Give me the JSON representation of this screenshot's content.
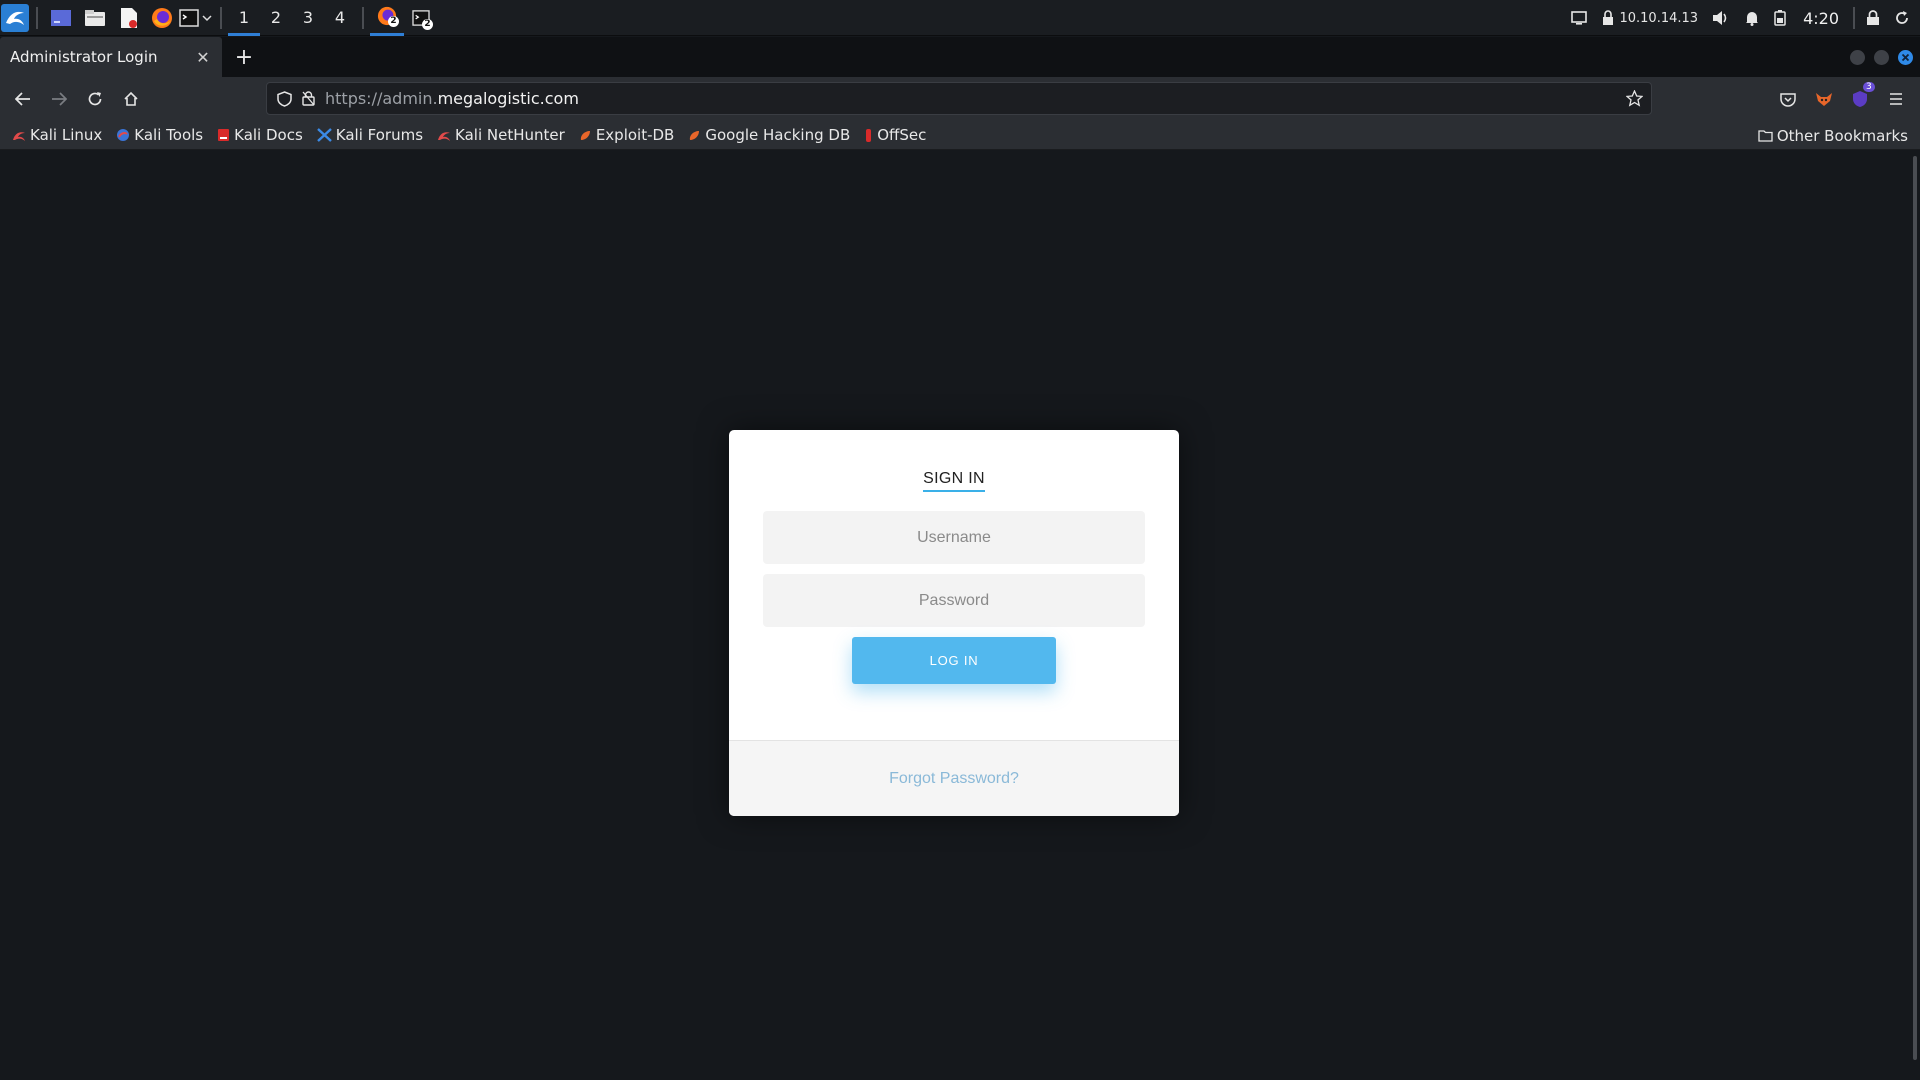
{
  "panel": {
    "workspaces": [
      "1",
      "2",
      "3",
      "4"
    ],
    "active_workspace": "1",
    "task_badges": [
      "2",
      "2"
    ],
    "ip_address": "10.10.14.13",
    "clock": "4:20"
  },
  "browser": {
    "tab_title": "Administrator Login",
    "url_scheme": "https://admin.",
    "url_host": "megalogistic.com",
    "extension_badge": "3"
  },
  "bookmarks": {
    "items": [
      "Kali Linux",
      "Kali Tools",
      "Kali Docs",
      "Kali Forums",
      "Kali NetHunter",
      "Exploit-DB",
      "Google Hacking DB",
      "OffSec"
    ],
    "other": "Other Bookmarks"
  },
  "login": {
    "title": "SIGN IN",
    "username_placeholder": "Username",
    "password_placeholder": "Password",
    "button_label": "LOG IN",
    "forgot_label": "Forgot Password?"
  },
  "colors": {
    "accent": "#52b8ee",
    "link": "#8ab9d8",
    "page_bg": "#15181c",
    "active_indicator": "#2f7fd6"
  }
}
